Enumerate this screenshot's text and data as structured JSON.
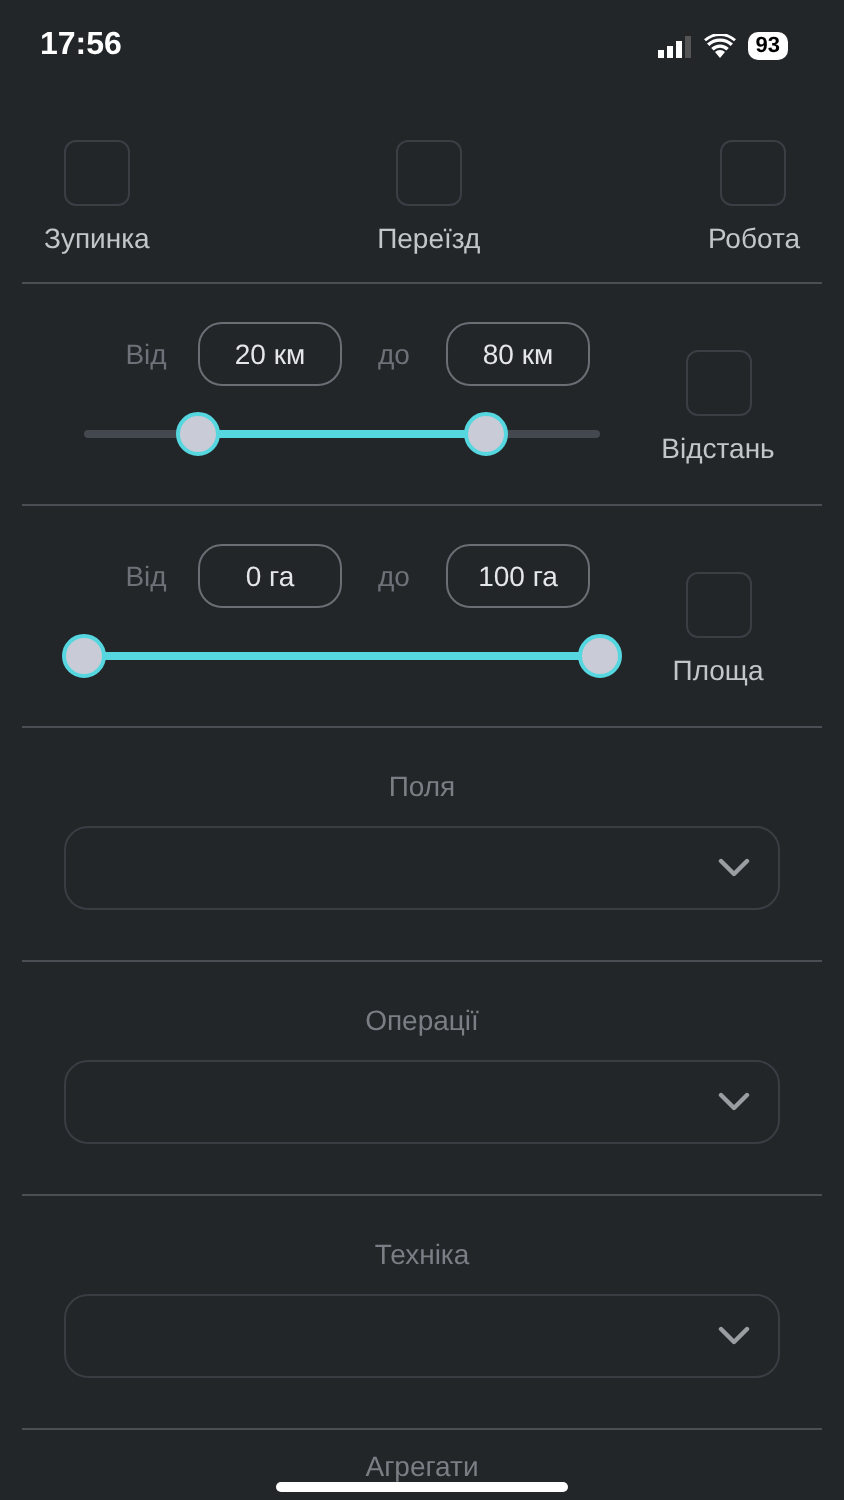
{
  "status_bar": {
    "time": "17:56",
    "battery": "93"
  },
  "types": [
    {
      "label": "Зупинка",
      "checked": false
    },
    {
      "label": "Переїзд",
      "checked": false
    },
    {
      "label": "Робота",
      "checked": false
    }
  ],
  "ranges": [
    {
      "from_label": "Від",
      "from": "20 км",
      "to_label": "до",
      "to": "80 км",
      "thumbs": [
        {
          "level": 0.22
        },
        {
          "level": 0.78
        }
      ],
      "label": "Відстань",
      "checked": false
    },
    {
      "from_label": "Від",
      "from": "0 га",
      "to_label": "до",
      "to": "100 га",
      "thumbs": [
        {
          "level": 0
        },
        {
          "level": 1
        }
      ],
      "label": "Площа",
      "checked": false
    }
  ],
  "dropdowns": [
    {
      "label": "Поля"
    },
    {
      "label": "Операції"
    },
    {
      "label": "Техніка"
    }
  ],
  "next_section": {
    "label": "Агрегати"
  }
}
